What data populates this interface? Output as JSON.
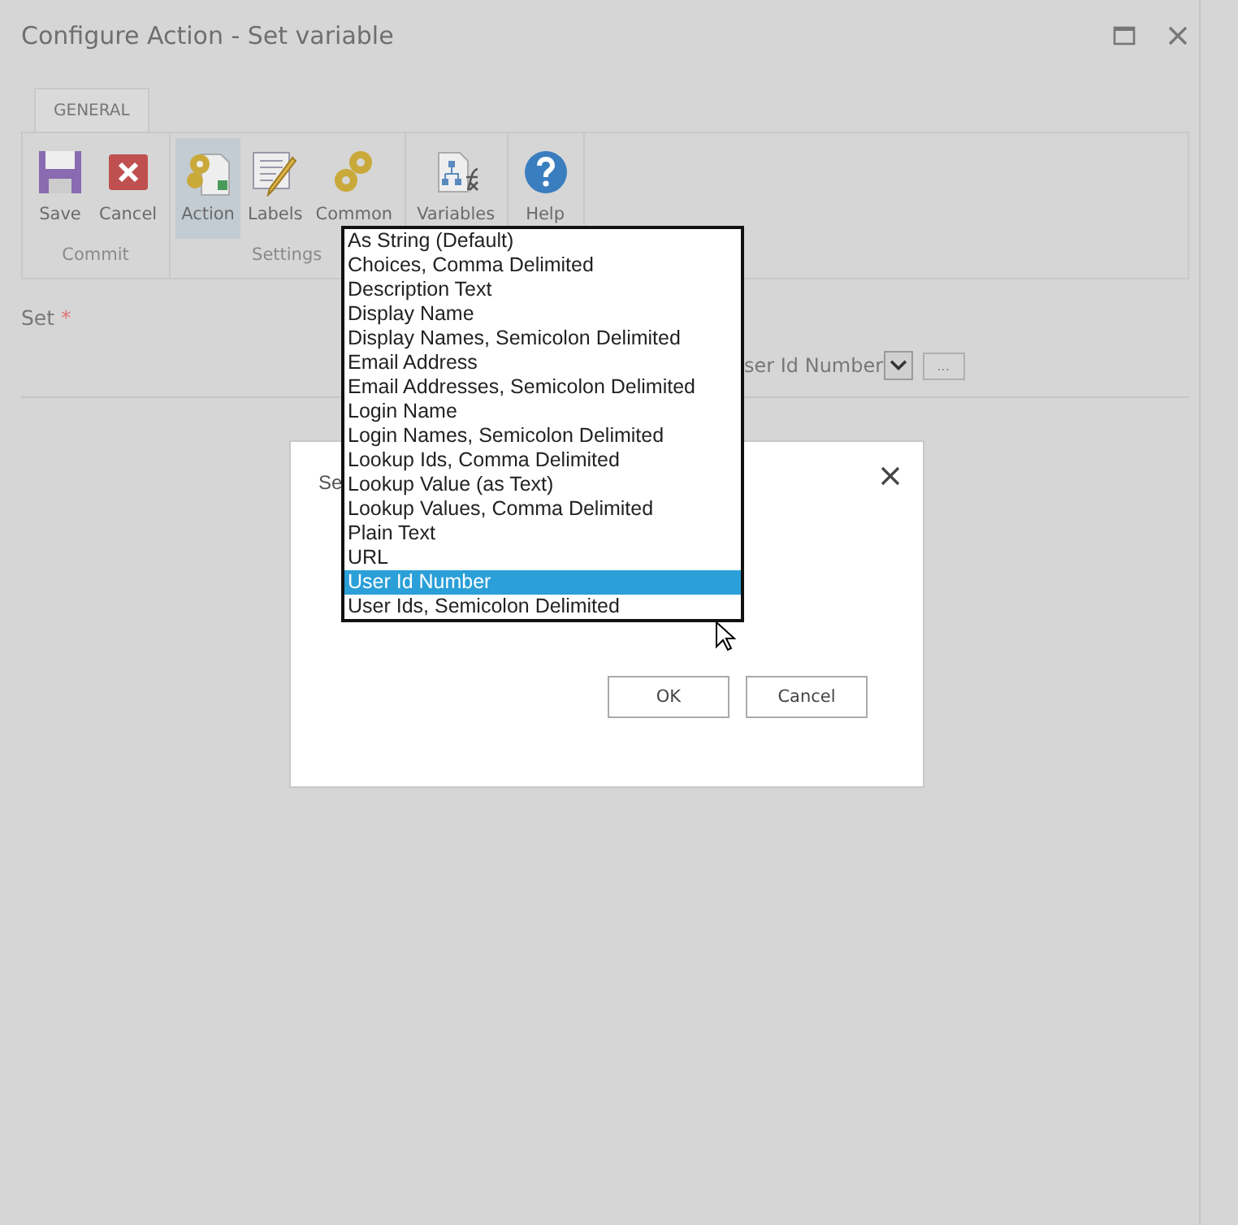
{
  "window": {
    "title": "Configure Action - Set variable"
  },
  "ribbon": {
    "tabs": [
      {
        "label": "GENERAL",
        "selected": true
      }
    ],
    "groups": [
      {
        "label": "Commit",
        "buttons": [
          {
            "label": "Save",
            "kind": "save",
            "selected": false
          },
          {
            "label": "Cancel",
            "kind": "cancel",
            "selected": false
          }
        ]
      },
      {
        "label": "Settings",
        "buttons": [
          {
            "label": "Action",
            "kind": "action",
            "selected": true
          },
          {
            "label": "Labels",
            "kind": "labels",
            "selected": false
          },
          {
            "label": "Common",
            "kind": "common",
            "selected": false
          }
        ]
      },
      {
        "buttons": [
          {
            "label": "Variables",
            "kind": "variables",
            "selected": false
          }
        ]
      },
      {
        "buttons": [
          {
            "label": "Help",
            "kind": "help",
            "selected": false
          }
        ]
      }
    ]
  },
  "form": {
    "label": "Set",
    "required_mark": "*",
    "select_value": "ser Id Number",
    "browse_button": "..."
  },
  "dialog": {
    "title": "Se",
    "buttons": [
      "OK",
      "Cancel"
    ]
  },
  "dropdown": {
    "options": [
      {
        "label": "As String (Default)",
        "selected": false
      },
      {
        "label": "Choices, Comma Delimited",
        "selected": false
      },
      {
        "label": "Description Text",
        "selected": false
      },
      {
        "label": "Display Name",
        "selected": false
      },
      {
        "label": "Display Names, Semicolon Delimited",
        "selected": false
      },
      {
        "label": "Email Address",
        "selected": false
      },
      {
        "label": "Email Addresses, Semicolon Delimited",
        "selected": false
      },
      {
        "label": "Login Name",
        "selected": false
      },
      {
        "label": "Login Names, Semicolon Delimited",
        "selected": false
      },
      {
        "label": "Lookup Ids, Comma Delimited",
        "selected": false
      },
      {
        "label": "Lookup Value (as Text)",
        "selected": false
      },
      {
        "label": "Lookup Values, Comma Delimited",
        "selected": false
      },
      {
        "label": "Plain Text",
        "selected": false
      },
      {
        "label": "URL",
        "selected": false
      },
      {
        "label": "User Id Number",
        "selected": true
      },
      {
        "label": "User Ids, Semicolon Delimited",
        "selected": false
      }
    ]
  }
}
